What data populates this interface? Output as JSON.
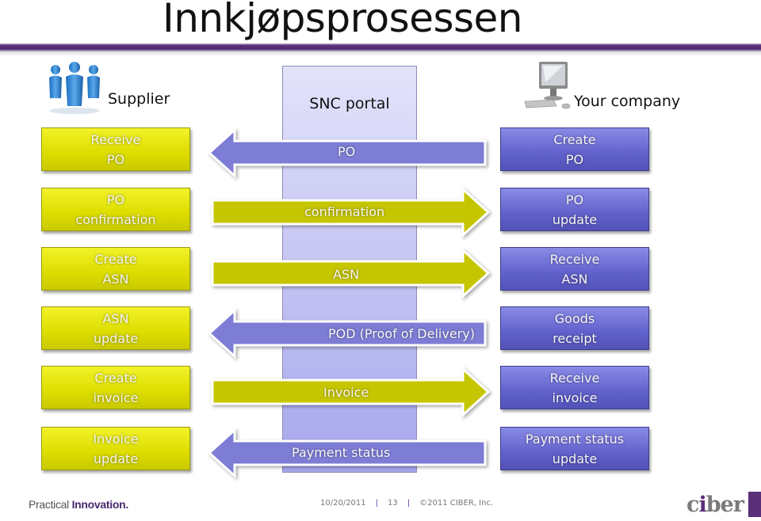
{
  "title": "Innkjøpsprosessen",
  "actors": {
    "supplier": {
      "label": "Supplier",
      "icon": "people-icon"
    },
    "portal": {
      "label": "SNC portal"
    },
    "company": {
      "label": "Your company",
      "icon": "computer-icon"
    }
  },
  "supplier_steps": [
    "Receive\nPO",
    "PO\nconfirmation",
    "Create\nASN",
    "ASN\nupdate",
    "Create\ninvoice",
    "Invoice\nupdate"
  ],
  "company_steps": [
    "Create\nPO",
    "PO\nupdate",
    "Receive\nASN",
    "Goods\nreceipt",
    "Receive\ninvoice",
    "Payment status\nupdate"
  ],
  "flows": [
    {
      "label": "PO",
      "direction": "left"
    },
    {
      "label": "confirmation",
      "direction": "right"
    },
    {
      "label": "ASN",
      "direction": "right"
    },
    {
      "label": "POD (Proof of Delivery)",
      "direction": "left"
    },
    {
      "label": "Invoice",
      "direction": "right"
    },
    {
      "label": "Payment status",
      "direction": "left"
    }
  ],
  "colors": {
    "supplier": "#dddd00",
    "company": "#6161cc",
    "flow_left": "#7d7dd6",
    "flow_right": "#c6c600",
    "portal": "#c4c4f4",
    "brand": "#5a2e79"
  },
  "footer": {
    "tagline_plain": "Practical ",
    "tagline_bold": "Innovation.",
    "date": "10/20/2011",
    "page": "13",
    "copyright": "©2011 CIBER, Inc.",
    "logo_pre": "c",
    "logo_i": "i",
    "logo_post": "ber"
  }
}
